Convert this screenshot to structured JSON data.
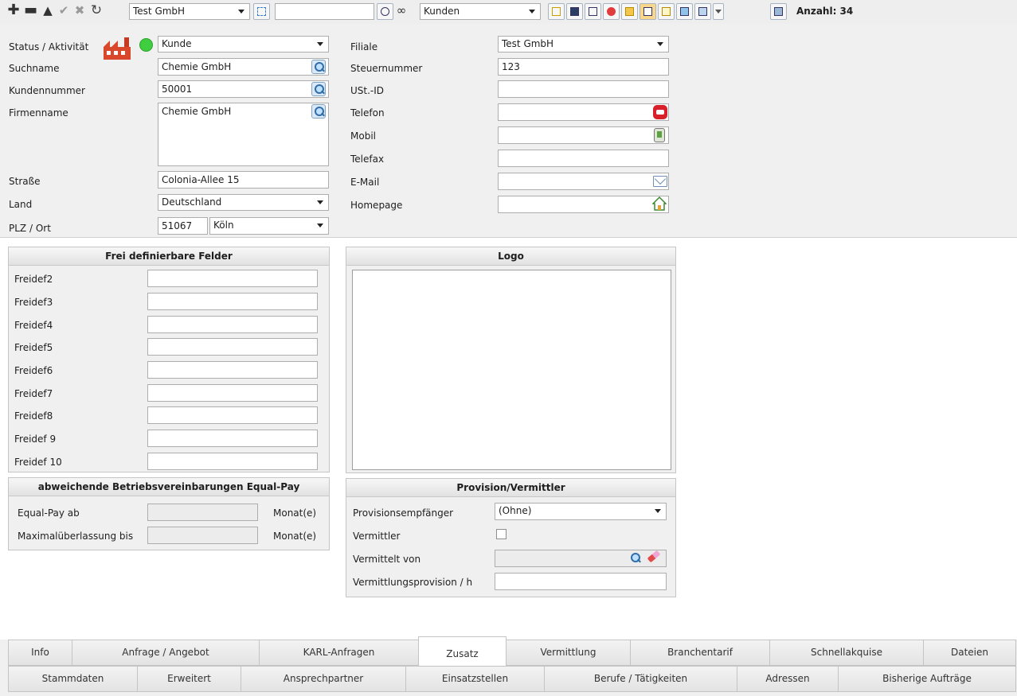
{
  "toolbar": {
    "company_select": "Test GmbH",
    "search_value": "",
    "module_select": "Kunden",
    "count_label": "Anzahl: 34"
  },
  "form": {
    "status_label": "Status / Aktivität",
    "status_value": "Kunde",
    "suchname_label": "Suchname",
    "suchname_value": "Chemie GmbH",
    "kundennummer_label": "Kundennummer",
    "kundennummer_value": "50001",
    "firmenname_label": "Firmenname",
    "firmenname_value": "Chemie GmbH",
    "strasse_label": "Straße",
    "strasse_value": "Colonia-Allee 15",
    "land_label": "Land",
    "land_value": "Deutschland",
    "plz_label": "PLZ / Ort",
    "plz_value": "51067",
    "ort_value": "Köln",
    "filiale_label": "Filiale",
    "filiale_value": "Test GmbH",
    "steuernummer_label": "Steuernummer",
    "steuernummer_value": "123",
    "ustid_label": "USt.-ID",
    "ustid_value": "",
    "telefon_label": "Telefon",
    "telefon_value": "",
    "mobil_label": "Mobil",
    "mobil_value": "",
    "telefax_label": "Telefax",
    "telefax_value": "",
    "email_label": "E-Mail",
    "email_value": "",
    "homepage_label": "Homepage",
    "homepage_value": ""
  },
  "freifelder": {
    "title": "Frei definierbare Felder",
    "fields": [
      {
        "label": "Freidef2",
        "value": ""
      },
      {
        "label": "Freidef3",
        "value": ""
      },
      {
        "label": "Freidef4",
        "value": ""
      },
      {
        "label": "Freidef5",
        "value": ""
      },
      {
        "label": "Freidef6",
        "value": ""
      },
      {
        "label": "Freidef7",
        "value": ""
      },
      {
        "label": "Freidef8",
        "value": ""
      },
      {
        "label": "Freidef 9",
        "value": ""
      },
      {
        "label": "Freidef 10",
        "value": ""
      }
    ]
  },
  "equalpay": {
    "title": "abweichende Betriebsvereinbarungen Equal-Pay",
    "ab_label": "Equal-Pay ab",
    "ab_unit": "Monat(e)",
    "max_label": "Maximalüberlassung bis",
    "max_unit": "Monat(e)"
  },
  "logo": {
    "title": "Logo"
  },
  "provision": {
    "title": "Provision/Vermittler",
    "empfaenger_label": "Provisionsempfänger",
    "empfaenger_value": "(Ohne)",
    "vermittler_label": "Vermittler",
    "vermittelt_von_label": "Vermittelt von",
    "vermittelt_von_value": "",
    "provision_label": "Vermittlungsprovision / h",
    "provision_value": ""
  },
  "tabs_top": [
    "Info",
    "Anfrage / Angebot",
    "KARL-Anfragen",
    "Zusatz",
    "Vermittlung",
    "Branchentarif",
    "Schnellakquise",
    "Dateien"
  ],
  "tabs_bottom": [
    "Stammdaten",
    "Erweitert",
    "Ansprechpartner",
    "Einsatzstellen",
    "Berufe / Tätigkeiten",
    "Adressen",
    "Bisherige Aufträge"
  ],
  "colors": {
    "status_green": "#3fce3f",
    "factory_red": "#d9482b",
    "phone_red": "#d8202a"
  }
}
